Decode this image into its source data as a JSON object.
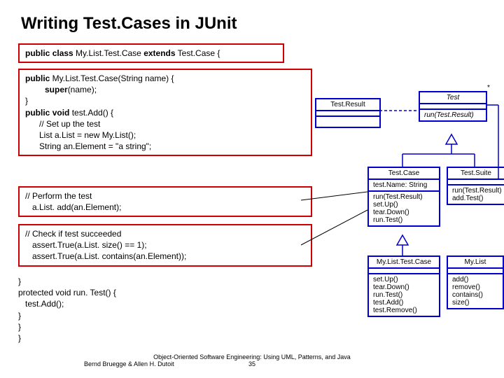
{
  "title": "Writing Test.Cases in JUnit",
  "code_header": "public class My.List.Test.Case extends Test.Case {",
  "code_main_l1": "public My.List.Test.Case(String name) {",
  "code_main_l2": "super(name);",
  "code_main_l3": "}",
  "code_main_l4": "public void test.Add() {",
  "code_main_l5": "// Set up the test",
  "code_main_l6": "List a.List = new My.List();",
  "code_main_l7": "String an.Element = \"a string\";",
  "code_perform_l1": "// Perform the test",
  "code_perform_l2": "a.List. add(an.Element);",
  "code_check_l1": "// Check if test succeeded",
  "code_check_l2": "assert.True(a.List. size() == 1);",
  "code_check_l3": "assert.True(a.List. contains(an.Element));",
  "code_tail_l1": "}",
  "code_tail_l2": "protected void run. Test() {",
  "code_tail_l3": "test.Add();",
  "code_tail_l4": "}",
  "code_tail_l5": "}",
  "code_tail_l6": "}",
  "kw_public": "public",
  "kw_class": "class",
  "kw_extends": "extends",
  "kw_void": "void",
  "kw_protected": "protected",
  "kw_super": "super",
  "uml": {
    "testresult": "Test.Result",
    "test": "Test",
    "test_op": "run(Test.Result)",
    "testcase": "Test.Case",
    "testsuite": "Test.Suite",
    "testsuite_ops": "run(Test.Result)\nadd.Test()",
    "testcase_attr": "test.Name: String",
    "testcase_ops": "run(Test.Result)\nset.Up()\ntear.Down()\nrun.Test()",
    "mylisttestcase": "My.List.Test.Case",
    "mylisttestcase_ops": "set.Up()\ntear.Down()\nrun.Test()\ntest.Add()\ntest.Remove()",
    "mylist": "My.List",
    "mylist_ops": "add()\nremove()\ncontains()\nsize()"
  },
  "mult_star": "*",
  "footer_left": "Bernd Bruegge & Allen H. Dutoit",
  "footer_center": "Object-Oriented Software Engineering: Using UML, Patterns, and Java",
  "footer_page": "35"
}
